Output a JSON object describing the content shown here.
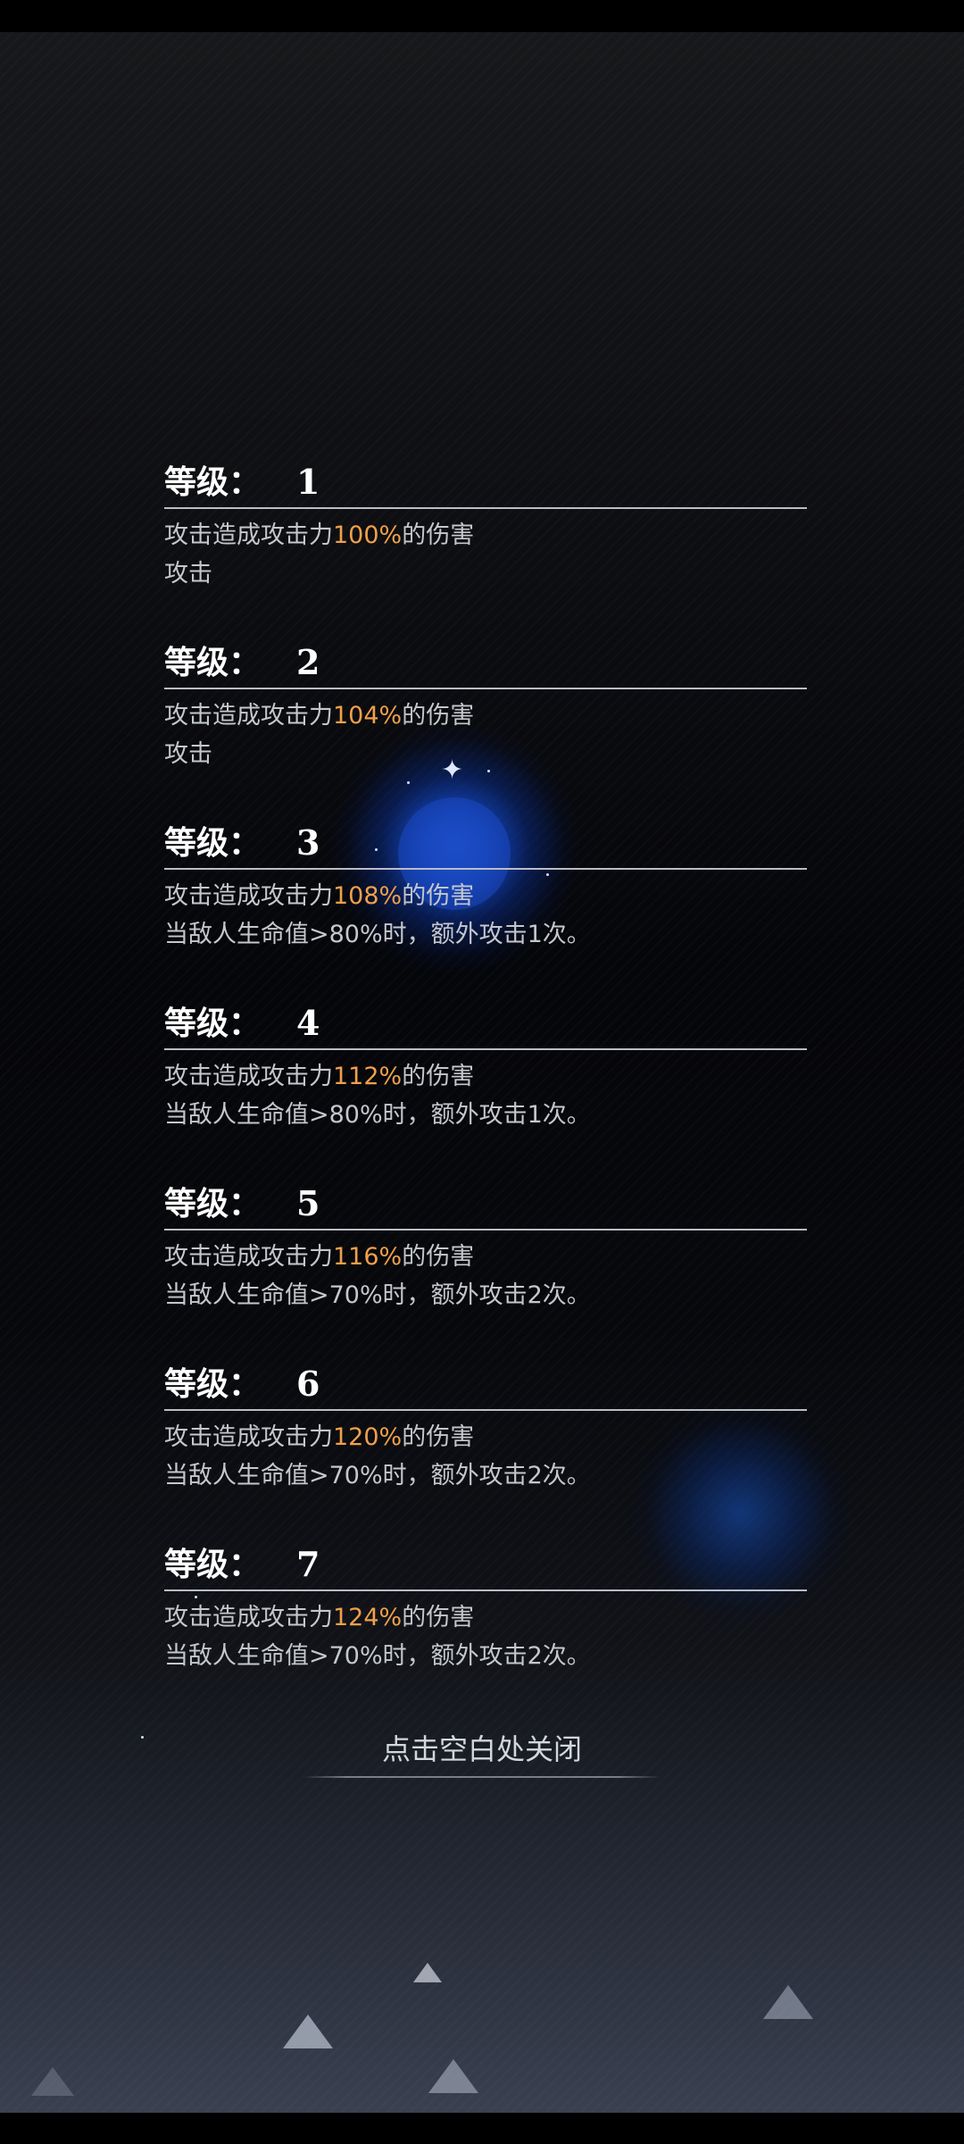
{
  "levels": [
    {
      "label": "等级：",
      "number": "1",
      "pre": "攻击造成攻击力",
      "percent": "100%",
      "post": "的伤害",
      "extra": "攻击"
    },
    {
      "label": "等级：",
      "number": "2",
      "pre": "攻击造成攻击力",
      "percent": "104%",
      "post": "的伤害",
      "extra": "攻击"
    },
    {
      "label": "等级：",
      "number": "3",
      "pre": "攻击造成攻击力",
      "percent": "108%",
      "post": "的伤害",
      "extra": "当敌人生命值>80%时，额外攻击1次。"
    },
    {
      "label": "等级：",
      "number": "4",
      "pre": "攻击造成攻击力",
      "percent": "112%",
      "post": "的伤害",
      "extra": "当敌人生命值>80%时，额外攻击1次。"
    },
    {
      "label": "等级：",
      "number": "5",
      "pre": "攻击造成攻击力",
      "percent": "116%",
      "post": "的伤害",
      "extra": "当敌人生命值>70%时，额外攻击2次。"
    },
    {
      "label": "等级：",
      "number": "6",
      "pre": "攻击造成攻击力",
      "percent": "120%",
      "post": "的伤害",
      "extra": "当敌人生命值>70%时，额外攻击2次。"
    },
    {
      "label": "等级：",
      "number": "7",
      "pre": "攻击造成攻击力",
      "percent": "124%",
      "post": "的伤害",
      "extra": "当敌人生命值>70%时，额外攻击2次。"
    }
  ],
  "close_hint": "点击空白处关闭",
  "colors": {
    "percent": "#f0a04b",
    "desc": "#c4c7cc",
    "heading": "#ffffff",
    "glow": "#2060ff"
  },
  "icons": {
    "sparkle": "sparkle-icon",
    "decor": "triangle-icon"
  }
}
